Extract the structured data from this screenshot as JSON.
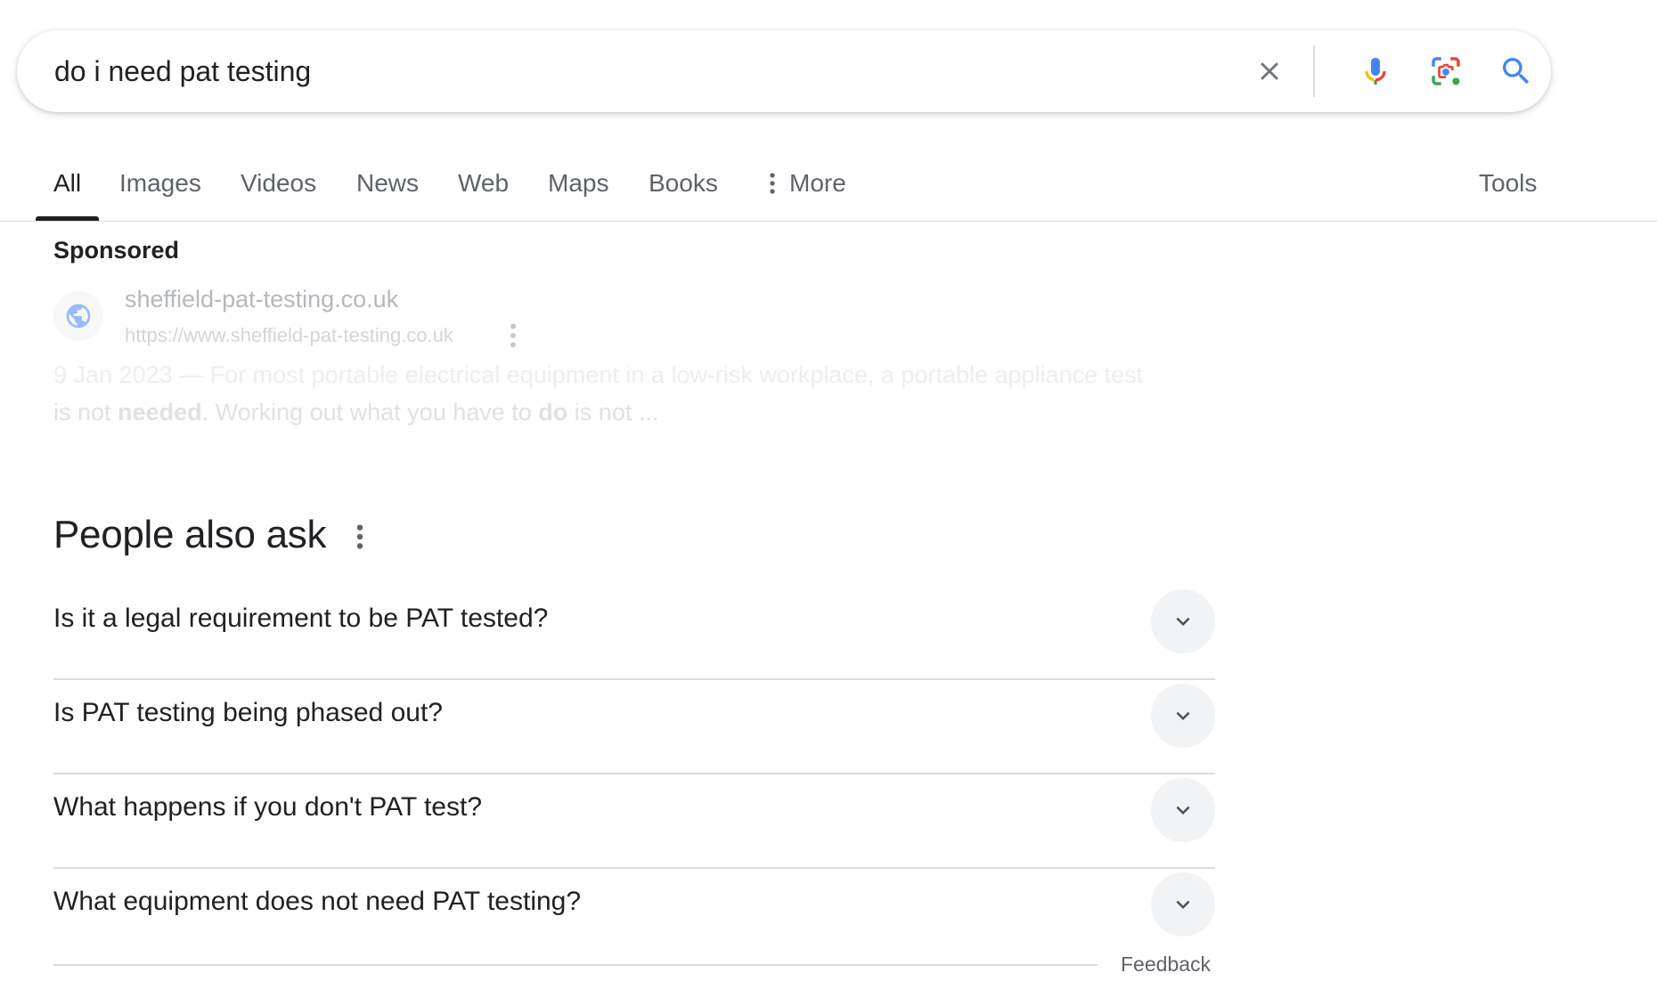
{
  "search": {
    "query": "do i need pat testing",
    "clear_icon": "close-icon",
    "mic_icon": "microphone-icon",
    "lens_icon": "camera-lens-icon",
    "search_icon": "search-icon"
  },
  "tabs": [
    {
      "label": "All",
      "active": true
    },
    {
      "label": "Images"
    },
    {
      "label": "Videos"
    },
    {
      "label": "News"
    },
    {
      "label": "Web"
    },
    {
      "label": "Maps"
    },
    {
      "label": "Books"
    },
    {
      "label": "More"
    }
  ],
  "tools_label": "Tools",
  "sponsored": {
    "label": "Sponsored",
    "site_name": "sheffield-pat-testing.co.uk",
    "url": "https://www.sheffield-pat-testing.co.uk",
    "snippet_line1": "9 Jan 2023 — For most portable electrical equipment in a low-risk workplace, a portable appliance test",
    "snippet_line2_prefix": "is not ",
    "snippet_line2_bold1": "needed",
    "snippet_line2_mid": ". Working out what you have to ",
    "snippet_line2_bold2": "do",
    "snippet_line2_suffix": " is not ..."
  },
  "people_also_ask": {
    "title": "People also ask",
    "questions": [
      "Is it a legal requirement to be PAT tested?",
      "Is PAT testing being phased out?",
      "What happens if you don't PAT test?",
      "What equipment does not need PAT testing?"
    ]
  },
  "feedback_label": "Feedback",
  "colors": {
    "mic_blue": "#4285f4",
    "mic_red": "#ea4335",
    "lens_yellow": "#fbbc04",
    "lens_green": "#34a853",
    "search_blue": "#4285f4"
  }
}
